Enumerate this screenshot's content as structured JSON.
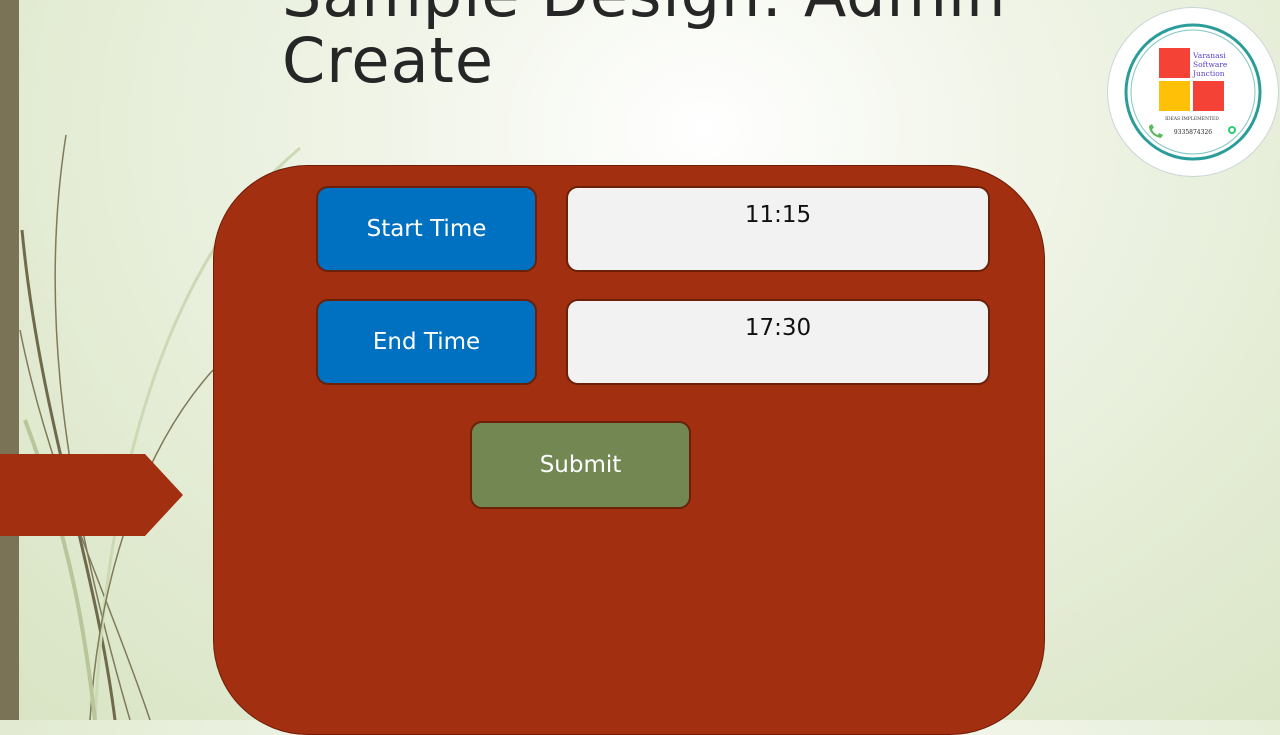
{
  "slide": {
    "title": "Sample Design: Admin\nCreate"
  },
  "logo": {
    "name": "Varanasi Software Junction",
    "name_line1": "Varanasi",
    "name_line2": "Software",
    "name_line3": "Junction",
    "tagline": "IDEAS IMPLEMENTED",
    "phone": "9335874326",
    "colors": {
      "red": "#f44336",
      "yellow": "#ffc107",
      "ring": "#2a9d9a",
      "text": "#5b3fc9"
    }
  },
  "form": {
    "start_time": {
      "label": "Start Time",
      "value": "11:15"
    },
    "end_time": {
      "label": "End Time",
      "value": "17:30"
    },
    "submit_label": "Submit"
  },
  "colors": {
    "panel": "#a22f0f",
    "label_button": "#0070c0",
    "submit_button": "#738753",
    "value_box": "#f2f2f2"
  }
}
